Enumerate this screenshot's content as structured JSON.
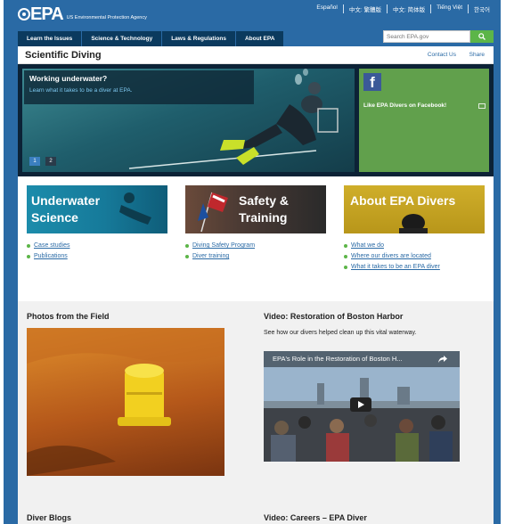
{
  "header": {
    "logo_text": "EPA",
    "agency_name": "US Environmental Protection Agency",
    "languages": [
      "Español",
      "中文: 繁體版",
      "中文: 简体版",
      "Tiếng Việt",
      "한국어"
    ]
  },
  "nav": {
    "items": [
      "Learn the Issues",
      "Science & Technology",
      "Laws & Regulations",
      "About EPA"
    ]
  },
  "search": {
    "placeholder": "Search EPA.gov"
  },
  "page": {
    "title": "Scientific Diving",
    "contact_label": "Contact Us",
    "share_label": "Share"
  },
  "hero": {
    "heading": "Working underwater?",
    "link_text": "Learn what it takes to be a diver at EPA.",
    "slides": [
      "1",
      "2"
    ],
    "facebook_text": "Like EPA Divers on Facebook!"
  },
  "cards": [
    {
      "title_line1": "Underwater",
      "title_line2": "Science",
      "links": [
        "Case studies",
        "Publications"
      ]
    },
    {
      "title_line1": "Safety &",
      "title_line2": "Training",
      "links": [
        "Diving Safety Program",
        "Diver training"
      ]
    },
    {
      "title_line1": "About EPA Divers",
      "title_line2": "",
      "links": [
        "What we do",
        "Where our divers are located",
        "What it takes to be an EPA diver"
      ]
    }
  ],
  "photos": {
    "heading": "Photos from the Field"
  },
  "video": {
    "heading": "Video: Restoration of Boston Harbor",
    "description": "See how our divers helped clean up this vital waterway.",
    "player_title": "EPA's Role in the Restoration of Boston H..."
  },
  "bottom": {
    "blogs_heading": "Diver Blogs",
    "careers_heading": "Video: Careers – EPA Diver"
  },
  "colors": {
    "header_blue": "#2a6aa5",
    "nav_dark": "#0b3a5e",
    "green": "#5cb548",
    "link_blue": "#2a6aa5"
  }
}
